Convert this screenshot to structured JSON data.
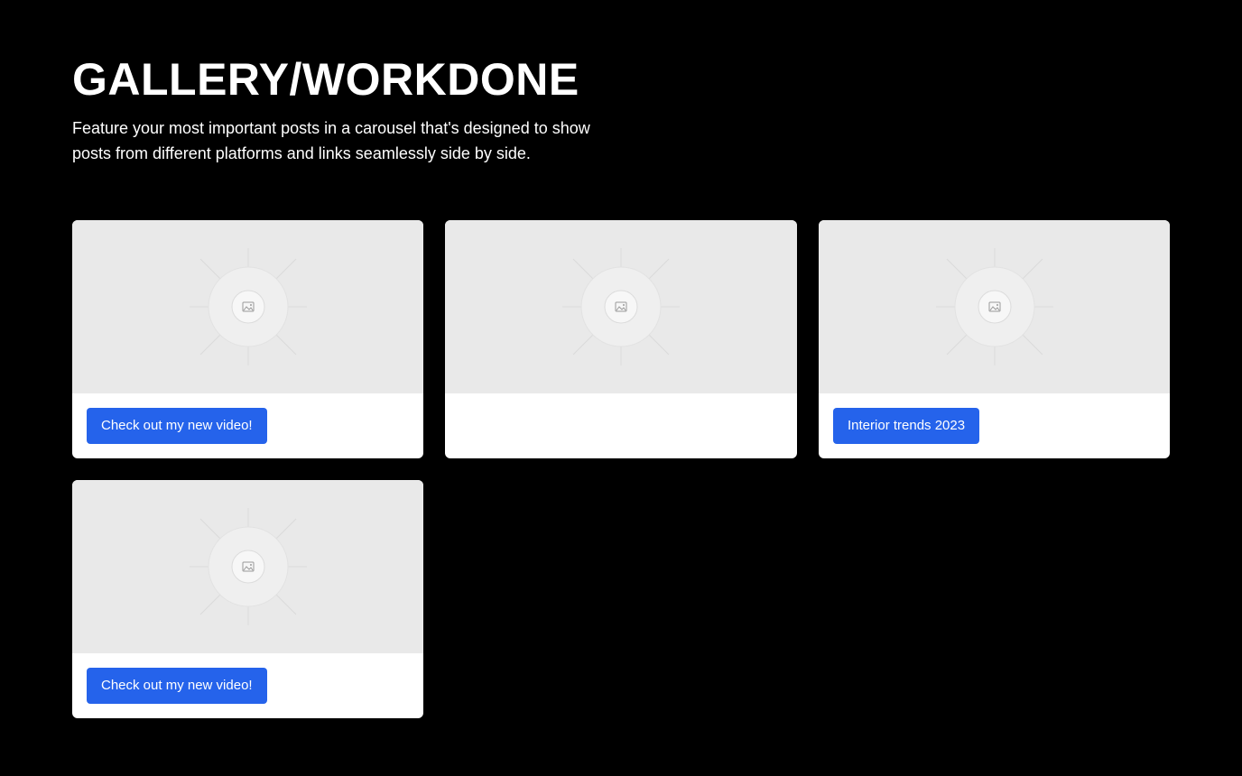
{
  "header": {
    "title": "GALLERY/WORKDONE",
    "description": "Feature your most important posts in a carousel that's designed to show posts from different platforms and links seamlessly side by side."
  },
  "cards": [
    {
      "image_icon": "image-placeholder-icon",
      "button_label": "Check out my new video!"
    },
    {
      "image_icon": "image-placeholder-icon",
      "button_label": ""
    },
    {
      "image_icon": "image-placeholder-icon",
      "button_label": "Interior trends 2023"
    },
    {
      "image_icon": "image-placeholder-icon",
      "button_label": "Check out my new video!"
    }
  ],
  "colors": {
    "background": "#000000",
    "card": "#ffffff",
    "placeholder": "#e9e9e9",
    "button": "#2563eb",
    "text": "#ffffff"
  }
}
